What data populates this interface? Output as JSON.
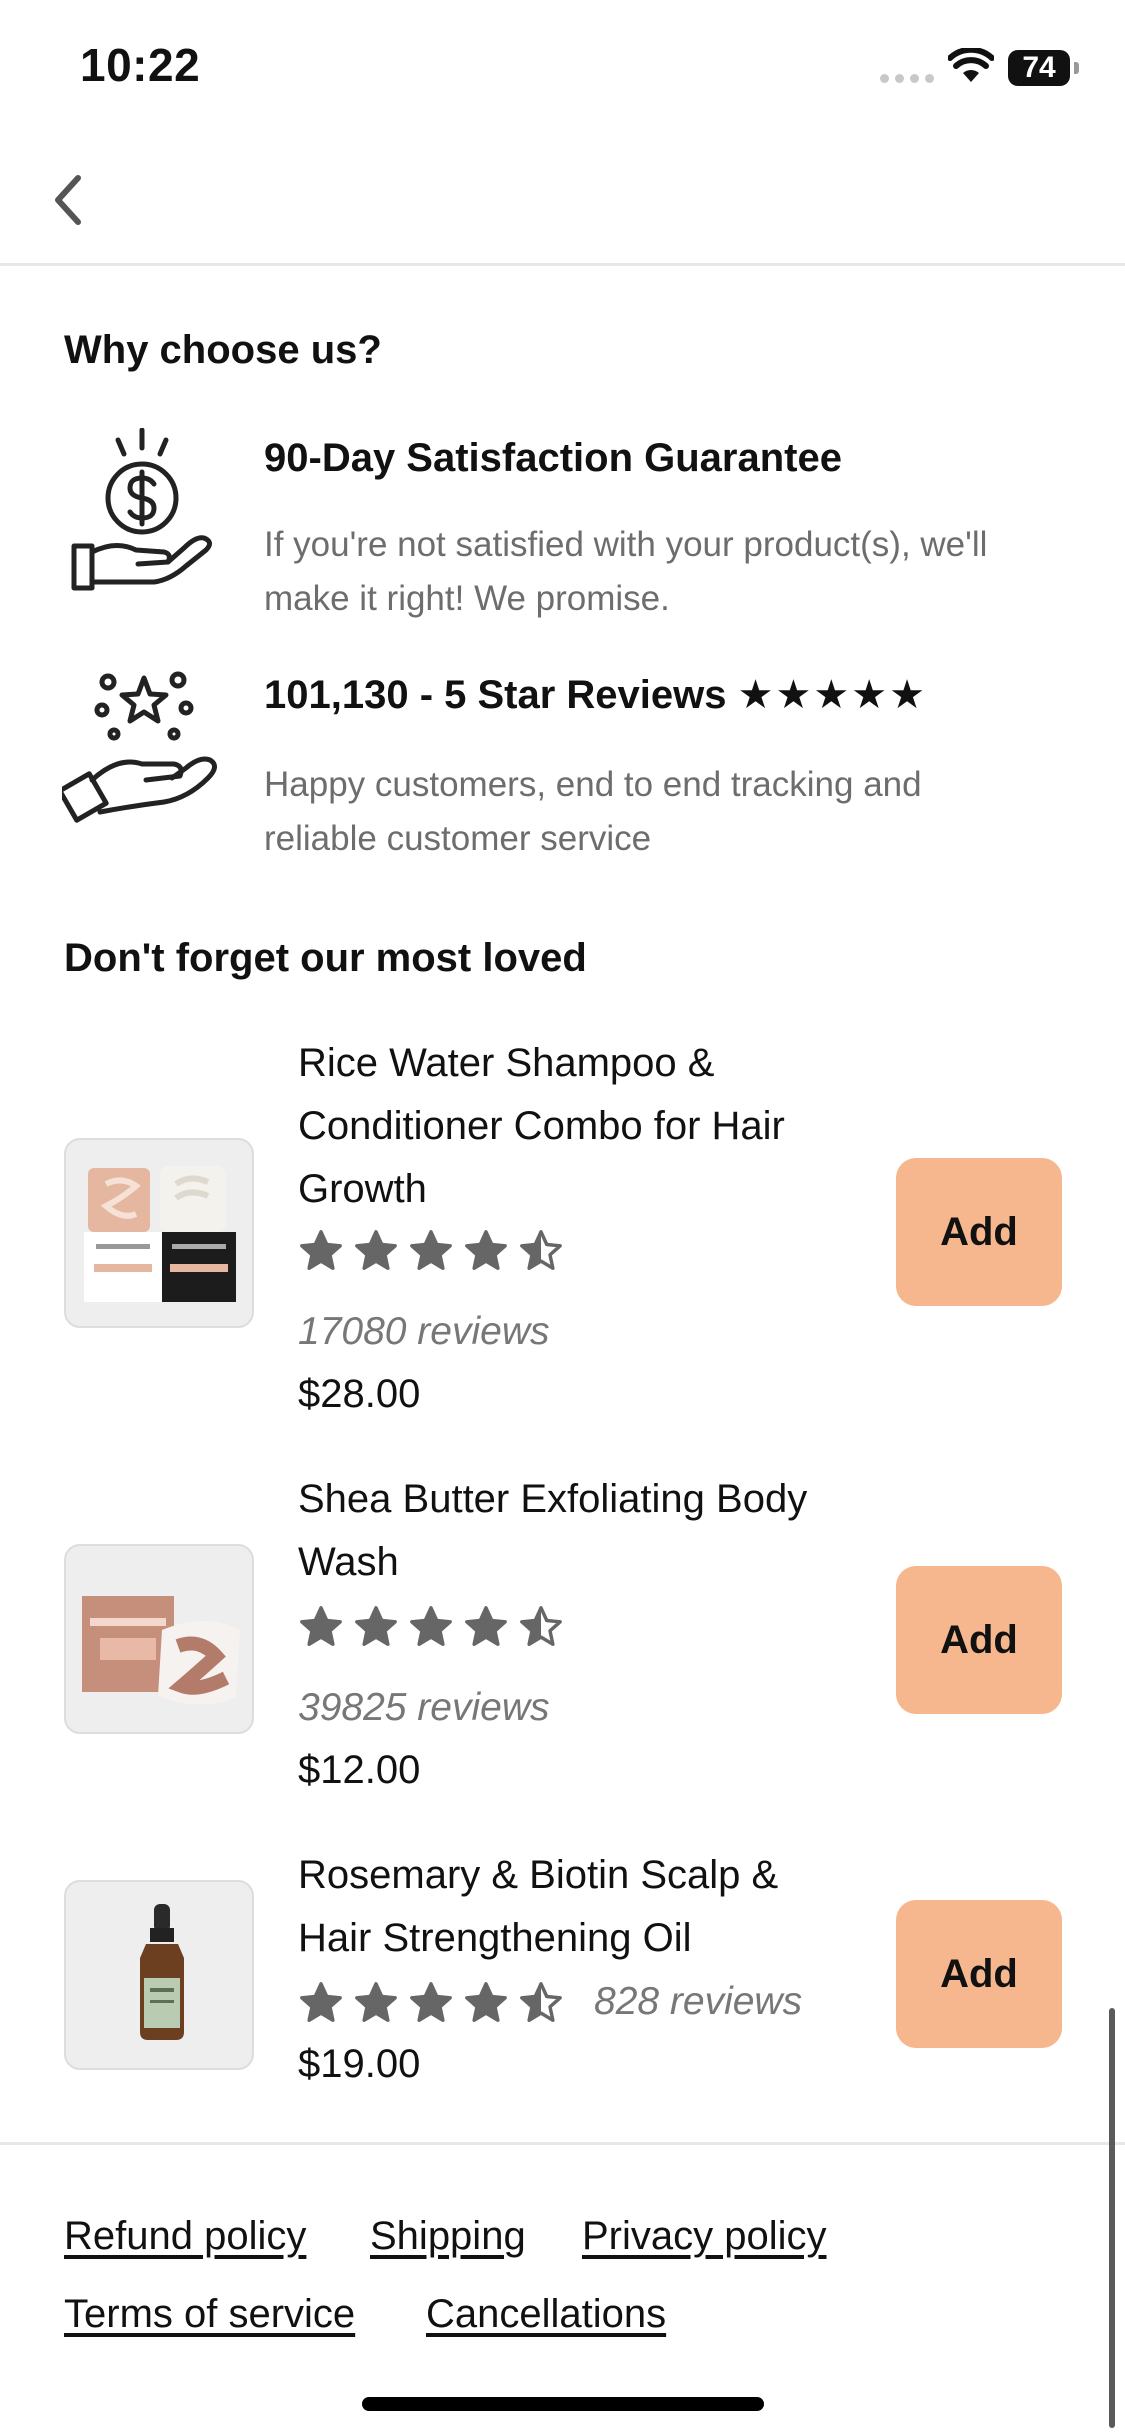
{
  "status_bar": {
    "time": "10:22",
    "battery": "74"
  },
  "why": {
    "title": "Why choose us?",
    "features": [
      {
        "title": "90-Day Satisfaction Guarantee",
        "desc": "If you're not satisfied with your product(s), we'll make it right! We promise.",
        "icon": "money-hand-icon"
      },
      {
        "title": "101,130 - 5 Star Reviews",
        "stars": "★★★★★",
        "desc": "Happy customers, end to end tracking and reliable customer service",
        "icon": "star-hand-icon"
      }
    ]
  },
  "loved": {
    "title": "Don't forget our most loved",
    "products": [
      {
        "name": "Rice Water Shampoo & Conditioner Combo for Hair Growth",
        "rating": 4.5,
        "reviews": "17080 reviews",
        "price": "$28.00",
        "add_label": "Add"
      },
      {
        "name": "Shea Butter Exfoliating Body Wash",
        "rating": 4.5,
        "reviews": "39825 reviews",
        "price": "$12.00",
        "add_label": "Add"
      },
      {
        "name": "Rosemary & Biotin Scalp & Hair Strengthening Oil",
        "rating": 4.5,
        "reviews": "828 reviews",
        "price": "$19.00",
        "add_label": "Add"
      }
    ]
  },
  "footer": {
    "links": [
      "Refund policy",
      "Shipping",
      "Privacy policy",
      "Terms of service",
      "Cancellations"
    ]
  },
  "colors": {
    "add_button": "#f6b68e",
    "star": "#666666",
    "muted_text": "#6d6d6d"
  }
}
